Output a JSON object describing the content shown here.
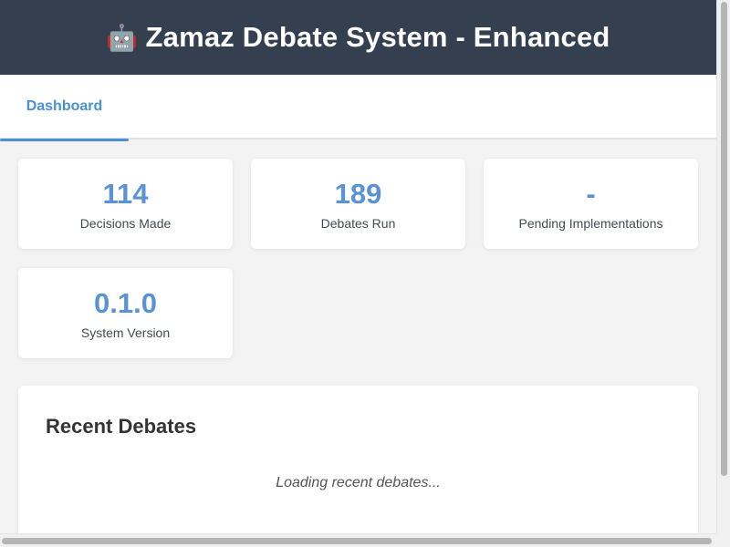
{
  "header": {
    "icon": "robot-icon",
    "icon_glyph": "🤖",
    "title": "Zamaz Debate System - Enhanced"
  },
  "tabs": [
    {
      "label": "Dashboard",
      "active": true
    }
  ],
  "stats": [
    {
      "value": "114",
      "label": "Decisions Made"
    },
    {
      "value": "189",
      "label": "Debates Run"
    },
    {
      "value": "-",
      "label": "Pending Implementations"
    },
    {
      "value": "0.1.0",
      "label": "System Version"
    }
  ],
  "recent_debates": {
    "title": "Recent Debates",
    "loading_text": "Loading recent debates..."
  },
  "colors": {
    "header_bg": "#343f4f",
    "accent": "#4a90d9",
    "stat_value": "#5a93d3",
    "page_bg": "#f3f3f3"
  }
}
